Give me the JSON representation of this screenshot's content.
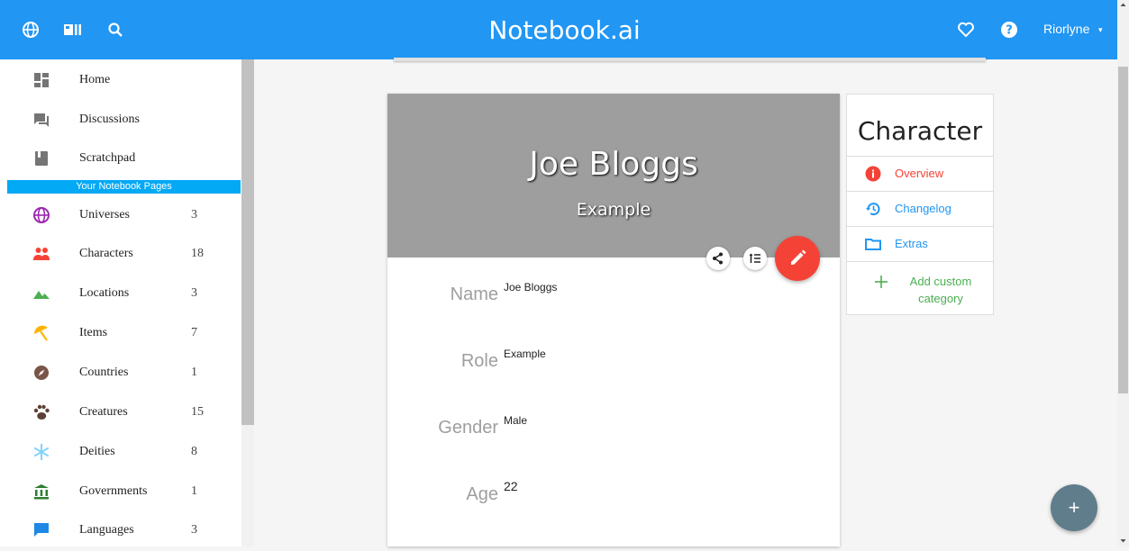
{
  "app": {
    "title": "Notebook.ai",
    "user": "Riorlyne",
    "caret": "▾"
  },
  "sidebar": {
    "items_top": [
      {
        "label": "Home",
        "icon": "dashboard-icon",
        "color": "#757575"
      },
      {
        "label": "Discussions",
        "icon": "forum-icon",
        "color": "#757575"
      },
      {
        "label": "Scratchpad",
        "icon": "book-icon",
        "color": "#757575"
      }
    ],
    "section": "Your Notebook Pages",
    "pages": [
      {
        "label": "Universes",
        "count": "3",
        "icon": "globe-icon",
        "color": "#9c27b0"
      },
      {
        "label": "Characters",
        "count": "18",
        "icon": "group-icon",
        "color": "#f44336"
      },
      {
        "label": "Locations",
        "count": "3",
        "icon": "terrain-icon",
        "color": "#4caf50"
      },
      {
        "label": "Items",
        "count": "7",
        "icon": "umbrella-icon",
        "color": "#ffb300"
      },
      {
        "label": "Countries",
        "count": "1",
        "icon": "compass-icon",
        "color": "#795548"
      },
      {
        "label": "Creatures",
        "count": "15",
        "icon": "paw-icon",
        "color": "#5d4037"
      },
      {
        "label": "Deities",
        "count": "8",
        "icon": "snowflake-icon",
        "color": "#81d4fa"
      },
      {
        "label": "Governments",
        "count": "1",
        "icon": "bank-icon",
        "color": "#2e7d32"
      },
      {
        "label": "Languages",
        "count": "3",
        "icon": "chat-icon",
        "color": "#1e88e5"
      }
    ]
  },
  "card": {
    "name": "Joe Bloggs",
    "subtitle": "Example",
    "fields": [
      {
        "label": "Name",
        "value": "Joe Bloggs"
      },
      {
        "label": "Role",
        "value": "Example"
      },
      {
        "label": "Gender",
        "value": "Male"
      },
      {
        "label": "Age",
        "value": "22"
      }
    ]
  },
  "categories": {
    "title": "Character",
    "rows": [
      {
        "label": "Overview",
        "icon": "info-icon",
        "color": "#f44336"
      },
      {
        "label": "Changelog",
        "icon": "history-icon",
        "color": "#2196f3"
      },
      {
        "label": "Extras",
        "icon": "folder-icon",
        "color": "#2196f3"
      },
      {
        "label": "Add custom category",
        "icon": "plus-icon",
        "color": "#4caf50"
      }
    ]
  },
  "fab": {
    "plus": "+"
  }
}
